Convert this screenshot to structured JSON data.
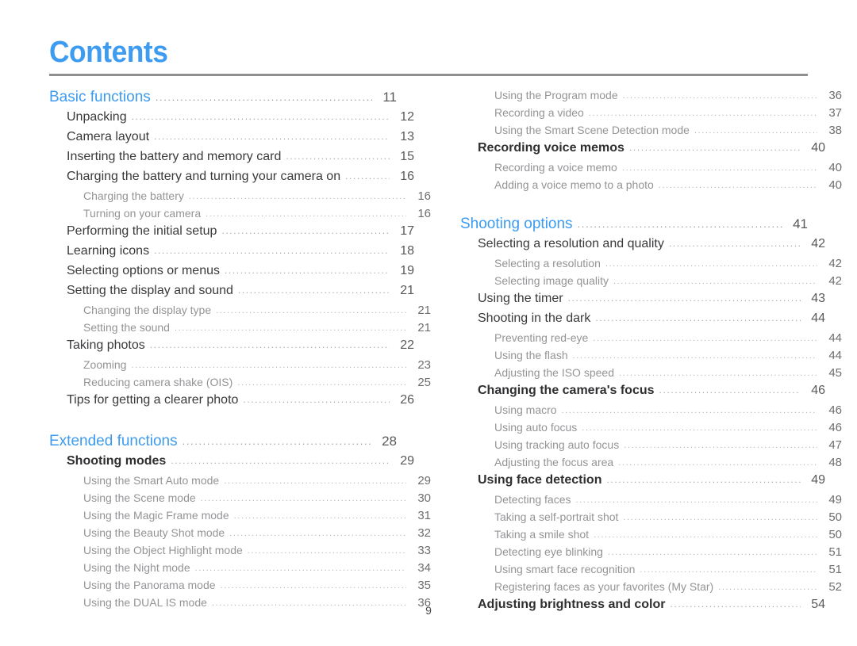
{
  "document": {
    "title": "Contents",
    "folio": "9",
    "accent_color": "#3d9bf0",
    "rule_color": "#8f8f8f",
    "level2_color": "#3a3a3c",
    "level3_color": "#949497"
  },
  "left_column": [
    {
      "level": 1,
      "label": "Basic functions",
      "page": "11"
    },
    {
      "level": 2,
      "label": "Unpacking",
      "page": "12"
    },
    {
      "level": 2,
      "label": "Camera layout",
      "page": "13"
    },
    {
      "level": 2,
      "label": "Inserting the battery and memory card",
      "page": "15"
    },
    {
      "level": 2,
      "label": "Charging the battery and turning your camera on",
      "page": "16"
    },
    {
      "level": 3,
      "label": "Charging the battery",
      "page": "16"
    },
    {
      "level": 3,
      "label": "Turning on your camera",
      "page": "16"
    },
    {
      "level": 2,
      "label": "Performing the initial setup",
      "page": "17"
    },
    {
      "level": 2,
      "label": "Learning icons",
      "page": "18"
    },
    {
      "level": 2,
      "label": "Selecting options or menus",
      "page": "19"
    },
    {
      "level": 2,
      "label": "Setting the display and sound",
      "page": "21"
    },
    {
      "level": 3,
      "label": "Changing the display type",
      "page": "21"
    },
    {
      "level": 3,
      "label": "Setting the sound",
      "page": "21"
    },
    {
      "level": 2,
      "label": "Taking photos",
      "page": "22"
    },
    {
      "level": 3,
      "label": "Zooming",
      "page": "23"
    },
    {
      "level": 3,
      "label": "Reducing camera shake (OIS)",
      "page": "25"
    },
    {
      "level": 2,
      "label": "Tips for getting a clearer photo",
      "page": "26"
    },
    {
      "level": 0,
      "label": "",
      "page": ""
    },
    {
      "level": 1,
      "label": "Extended functions",
      "page": "28"
    },
    {
      "level": 2,
      "label": "Shooting modes",
      "page": "29",
      "strong": true
    },
    {
      "level": 3,
      "label": "Using the Smart Auto mode",
      "page": "29"
    },
    {
      "level": 3,
      "label": "Using the Scene mode",
      "page": "30"
    },
    {
      "level": 3,
      "label": "Using the Magic Frame mode",
      "page": "31"
    },
    {
      "level": 3,
      "label": "Using the Beauty Shot mode",
      "page": "32"
    },
    {
      "level": 3,
      "label": "Using the Object Highlight mode",
      "page": "33"
    },
    {
      "level": 3,
      "label": "Using the Night mode",
      "page": "34"
    },
    {
      "level": 3,
      "label": "Using the Panorama mode",
      "page": "35"
    },
    {
      "level": 3,
      "label": "Using the DUAL IS mode",
      "page": "36"
    }
  ],
  "right_column": [
    {
      "level": 3,
      "label": "Using the Program mode",
      "page": "36"
    },
    {
      "level": 3,
      "label": "Recording a video",
      "page": "37"
    },
    {
      "level": 3,
      "label": "Using the Smart Scene Detection mode",
      "page": "38"
    },
    {
      "level": 2,
      "label": "Recording voice memos",
      "page": "40",
      "strong": true
    },
    {
      "level": 3,
      "label": "Recording a voice memo",
      "page": "40"
    },
    {
      "level": 3,
      "label": "Adding a voice memo to a photo",
      "page": "40"
    },
    {
      "level": 0,
      "label": "",
      "page": ""
    },
    {
      "level": 1,
      "label": "Shooting options",
      "page": "41"
    },
    {
      "level": 2,
      "label": "Selecting a resolution and quality",
      "page": "42"
    },
    {
      "level": 3,
      "label": "Selecting a resolution",
      "page": "42"
    },
    {
      "level": 3,
      "label": "Selecting image quality",
      "page": "42"
    },
    {
      "level": 2,
      "label": "Using the timer",
      "page": "43"
    },
    {
      "level": 2,
      "label": "Shooting in the dark",
      "page": "44"
    },
    {
      "level": 3,
      "label": "Preventing red-eye",
      "page": "44"
    },
    {
      "level": 3,
      "label": "Using the flash",
      "page": "44"
    },
    {
      "level": 3,
      "label": "Adjusting the ISO speed",
      "page": "45"
    },
    {
      "level": 2,
      "label": "Changing the camera's focus",
      "page": "46",
      "strong": true
    },
    {
      "level": 3,
      "label": "Using macro",
      "page": "46"
    },
    {
      "level": 3,
      "label": "Using auto focus",
      "page": "46"
    },
    {
      "level": 3,
      "label": "Using tracking auto focus",
      "page": "47"
    },
    {
      "level": 3,
      "label": "Adjusting the focus area",
      "page": "48"
    },
    {
      "level": 2,
      "label": "Using face detection",
      "page": "49",
      "strong": true
    },
    {
      "level": 3,
      "label": "Detecting faces",
      "page": "49"
    },
    {
      "level": 3,
      "label": "Taking a self-portrait shot",
      "page": "50"
    },
    {
      "level": 3,
      "label": "Taking a smile shot",
      "page": "50"
    },
    {
      "level": 3,
      "label": "Detecting eye blinking",
      "page": "51"
    },
    {
      "level": 3,
      "label": "Using smart face recognition",
      "page": "51"
    },
    {
      "level": 3,
      "label": "Registering faces as your favorites (My Star)",
      "page": "52"
    },
    {
      "level": 2,
      "label": "Adjusting brightness and color",
      "page": "54",
      "strong": true
    }
  ]
}
